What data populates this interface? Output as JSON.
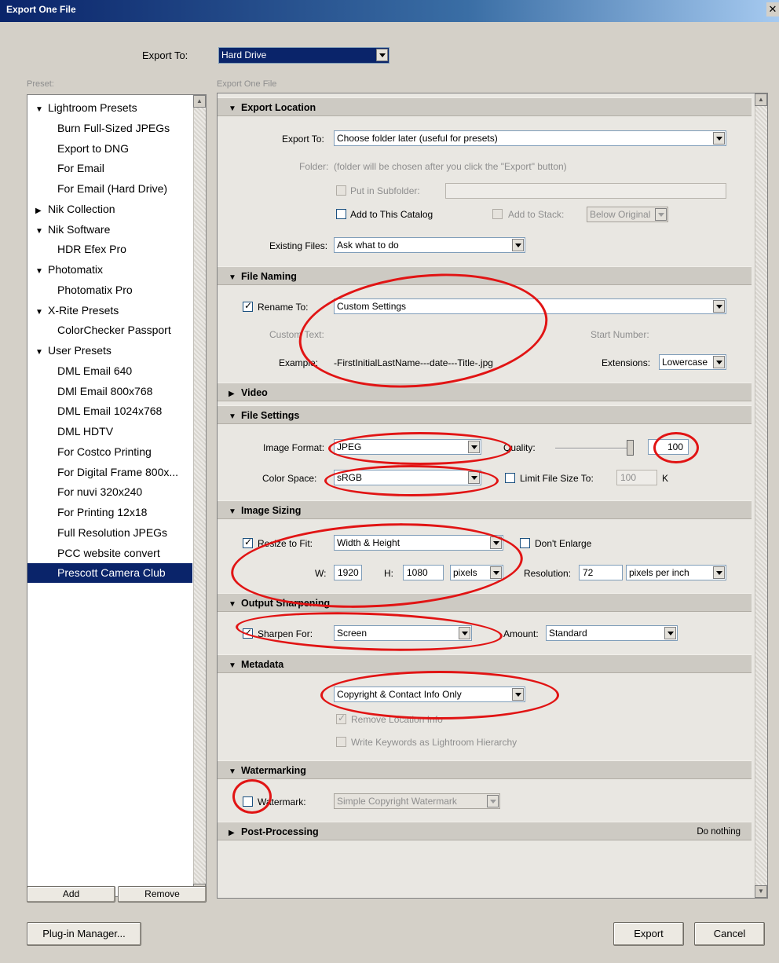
{
  "window": {
    "title": "Export One File",
    "close_icon": "close-icon"
  },
  "top": {
    "export_to_label": "Export To:",
    "export_to_value": "Hard Drive"
  },
  "left": {
    "preset_label": "Preset:",
    "items": [
      {
        "label": "Lightroom Presets",
        "type": "folder",
        "expanded": true
      },
      {
        "label": "Burn Full-Sized JPEGs",
        "type": "leaf"
      },
      {
        "label": "Export to DNG",
        "type": "leaf"
      },
      {
        "label": "For Email",
        "type": "leaf"
      },
      {
        "label": "For Email (Hard Drive)",
        "type": "leaf"
      },
      {
        "label": "Nik Collection",
        "type": "folder",
        "expanded": false
      },
      {
        "label": "Nik Software",
        "type": "folder",
        "expanded": true
      },
      {
        "label": "HDR Efex Pro",
        "type": "leaf"
      },
      {
        "label": "Photomatix",
        "type": "folder",
        "expanded": true
      },
      {
        "label": "Photomatix Pro",
        "type": "leaf"
      },
      {
        "label": "X-Rite Presets",
        "type": "folder",
        "expanded": true
      },
      {
        "label": "ColorChecker Passport",
        "type": "leaf"
      },
      {
        "label": "User Presets",
        "type": "folder",
        "expanded": true
      },
      {
        "label": "DML Email 640",
        "type": "leaf"
      },
      {
        "label": "DMl Email 800x768",
        "type": "leaf"
      },
      {
        "label": "DML Email 1024x768",
        "type": "leaf"
      },
      {
        "label": "DML HDTV",
        "type": "leaf"
      },
      {
        "label": "For Costco Printing",
        "type": "leaf"
      },
      {
        "label": "For Digital Frame 800x...",
        "type": "leaf"
      },
      {
        "label": "For nuvi 320x240",
        "type": "leaf"
      },
      {
        "label": "For Printing 12x18",
        "type": "leaf"
      },
      {
        "label": "Full Resolution JPEGs",
        "type": "leaf"
      },
      {
        "label": "PCC website convert",
        "type": "leaf"
      },
      {
        "label": "Prescott Camera Club",
        "type": "leaf",
        "selected": true
      }
    ],
    "add_label": "Add",
    "remove_label": "Remove"
  },
  "right": {
    "header": "Export One File",
    "export_location": {
      "title": "Export Location",
      "export_to_label": "Export To:",
      "export_to_value": "Choose folder later (useful for presets)",
      "folder_label": "Folder:",
      "folder_value": "(folder will be chosen after you click the \"Export\" button)",
      "subfolder_label": "Put in Subfolder:",
      "add_catalog_label": "Add to This Catalog",
      "add_stack_label": "Add to Stack:",
      "stack_value": "Below Original",
      "existing_label": "Existing Files:",
      "existing_value": "Ask what to do"
    },
    "file_naming": {
      "title": "File Naming",
      "rename_label": "Rename To:",
      "rename_value": "Custom Settings",
      "custom_text_label": "Custom Text:",
      "start_number_label": "Start Number:",
      "example_label": "Example:",
      "example_value": "-FirstInitialLastName---date---Title-.jpg",
      "extensions_label": "Extensions:",
      "extensions_value": "Lowercase"
    },
    "video": {
      "title": "Video"
    },
    "file_settings": {
      "title": "File Settings",
      "format_label": "Image Format:",
      "format_value": "JPEG",
      "quality_label": "Quality:",
      "quality_value": "100",
      "color_space_label": "Color Space:",
      "color_space_value": "sRGB",
      "limit_label": "Limit File Size To:",
      "limit_value": "100",
      "limit_unit": "K"
    },
    "image_sizing": {
      "title": "Image Sizing",
      "resize_label": "Resize to Fit:",
      "resize_value": "Width & Height",
      "dont_enlarge_label": "Don't Enlarge",
      "w_label": "W:",
      "w_value": "1920",
      "h_label": "H:",
      "h_value": "1080",
      "unit_value": "pixels",
      "resolution_label": "Resolution:",
      "resolution_value": "72",
      "resolution_unit": "pixels per inch"
    },
    "output_sharpening": {
      "title": "Output Sharpening",
      "sharpen_label": "Sharpen For:",
      "sharpen_value": "Screen",
      "amount_label": "Amount:",
      "amount_value": "Standard"
    },
    "metadata": {
      "title": "Metadata",
      "metadata_value": "Copyright & Contact Info Only",
      "remove_location_label": "Remove Location Info",
      "write_keywords_label": "Write Keywords as Lightroom Hierarchy"
    },
    "watermarking": {
      "title": "Watermarking",
      "watermark_label": "Watermark:",
      "watermark_value": "Simple Copyright Watermark"
    },
    "post_processing": {
      "title": "Post-Processing",
      "value": "Do nothing"
    }
  },
  "bottom": {
    "plugin_manager_label": "Plug-in Manager...",
    "export_label": "Export",
    "cancel_label": "Cancel"
  },
  "colors": {
    "annotation_red": "#e11414",
    "selection_navy": "#0a246a"
  }
}
